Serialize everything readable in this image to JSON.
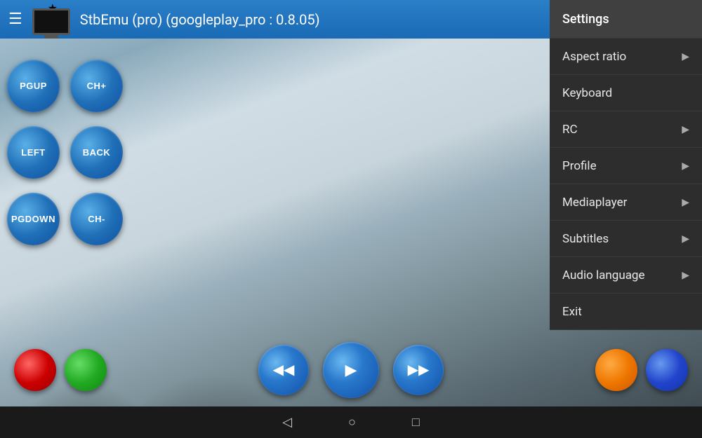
{
  "header": {
    "title": "StbEmu (pro) (googleplay_pro : 0.8.05)",
    "hamburger": "☰",
    "star": "★"
  },
  "contextMenu": {
    "items": [
      {
        "label": "Settings",
        "hasArrow": false,
        "id": "settings"
      },
      {
        "label": "Aspect ratio",
        "hasArrow": true,
        "id": "aspect-ratio"
      },
      {
        "label": "Keyboard",
        "hasArrow": false,
        "id": "keyboard"
      },
      {
        "label": "RC",
        "hasArrow": true,
        "id": "rc"
      },
      {
        "label": "Profile",
        "hasArrow": true,
        "id": "profile"
      },
      {
        "label": "Mediaplayer",
        "hasArrow": true,
        "id": "mediaplayer"
      },
      {
        "label": "Subtitles",
        "hasArrow": true,
        "id": "subtitles"
      },
      {
        "label": "Audio language",
        "hasArrow": true,
        "id": "audio-language"
      },
      {
        "label": "Exit",
        "hasArrow": false,
        "id": "exit"
      }
    ]
  },
  "controls": {
    "buttons": [
      {
        "label": "PGUP",
        "row": 0
      },
      {
        "label": "CH+",
        "row": 0
      },
      {
        "label": "LEFT",
        "row": 1
      },
      {
        "label": "BACK",
        "row": 1
      },
      {
        "label": "PGDOWN",
        "row": 2
      },
      {
        "label": "CH-",
        "row": 2
      }
    ]
  },
  "mediaControls": {
    "rewind": "⏮",
    "play": "▶",
    "forward": "⏭"
  },
  "bottomNav": {
    "back": "◁",
    "home": "○",
    "recent": "□"
  },
  "colors": {
    "headerBg": "#2070c0",
    "menuBg": "#2d2d2d",
    "menuActive": "#404040",
    "accent": "#2878cc"
  }
}
